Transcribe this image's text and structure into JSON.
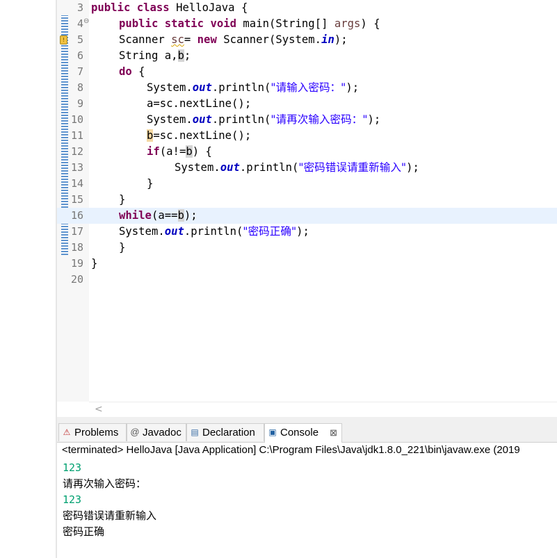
{
  "editor": {
    "lines": [
      {
        "num": "3",
        "tokens": [
          [
            "kw",
            "public"
          ],
          [
            "",
            "",
            " "
          ],
          [
            "kw",
            "class"
          ],
          [
            "",
            " HelloJava {"
          ]
        ]
      },
      {
        "num": "4",
        "fold": true
      },
      {
        "num": "5",
        "warning": true
      },
      {
        "num": "6"
      },
      {
        "num": "7"
      },
      {
        "num": "8"
      },
      {
        "num": "9"
      },
      {
        "num": "10"
      },
      {
        "num": "11"
      },
      {
        "num": "12"
      },
      {
        "num": "13"
      },
      {
        "num": "14"
      },
      {
        "num": "15"
      },
      {
        "num": "16",
        "current": true
      },
      {
        "num": "17"
      },
      {
        "num": "18"
      },
      {
        "num": "19"
      },
      {
        "num": "20"
      }
    ],
    "code": {
      "l3_kw1": "public",
      "l3_kw2": "class",
      "l3_rest": " HelloJava {",
      "l4_kw1": "public",
      "l4_kw2": "static",
      "l4_kw3": "void",
      "l4_rest1": " main(String[] ",
      "l4_args": "args",
      "l4_rest2": ") {",
      "l5_a": "Scanner ",
      "l5_sc": "sc",
      "l5_b": "= ",
      "l5_new": "new",
      "l5_c": " Scanner(System.",
      "l5_in": "in",
      "l5_d": ");",
      "l6_a": "String a,",
      "l6_b": "b",
      "l6_c": ";",
      "l7_do": "do",
      "l7_rest": " {",
      "l8_a": "System.",
      "l8_out": "out",
      "l8_b": ".println(",
      "l8_str": "\"请输入密码：\"",
      "l8_c": ");",
      "l9": "a=sc.nextLine();",
      "l10_a": "System.",
      "l10_out": "out",
      "l10_b": ".println(",
      "l10_str": "\"请再次输入密码：\"",
      "l10_c": ");",
      "l11_b": "b",
      "l11_rest": "=sc.nextLine();",
      "l12_if": "if",
      "l12_a": "(a!=",
      "l12_b": "b",
      "l12_c": ") {",
      "l13_a": "System.",
      "l13_out": "out",
      "l13_b": ".println(",
      "l13_str": "\"密码错误请重新输入\"",
      "l13_c": ");",
      "l14": "}",
      "l15": "}",
      "l16_while": "while",
      "l16_a": "(a==",
      "l16_b": "b",
      "l16_c": ");",
      "l17_a": "System.",
      "l17_out": "out",
      "l17_b": ".println(",
      "l17_str": "\"密码正确\"",
      "l17_c": ");",
      "l18": "}",
      "l19": "}",
      "l20": ""
    },
    "scroll_arrow": "<"
  },
  "console": {
    "tabs": [
      {
        "label": "Problems",
        "icon": "problems-icon"
      },
      {
        "label": "Javadoc",
        "icon": "javadoc-icon",
        "glyph": "@"
      },
      {
        "label": "Declaration",
        "icon": "declaration-icon"
      },
      {
        "label": "Console",
        "icon": "console-icon",
        "active": true,
        "close": "⊠"
      }
    ],
    "status": "<terminated> HelloJava [Java Application] C:\\Program Files\\Java\\jdk1.8.0_221\\bin\\javaw.exe (2019",
    "output": [
      {
        "text": "123",
        "kind": "input"
      },
      {
        "text": "请再次输入密码：",
        "kind": "normal"
      },
      {
        "text": "123",
        "kind": "input"
      },
      {
        "text": "密码错误请重新输入",
        "kind": "normal"
      },
      {
        "text": "密码正确",
        "kind": "normal"
      }
    ]
  },
  "colors": {
    "keyword": "#7f0055",
    "field": "#0000c0",
    "string": "#2a00ff",
    "console_input": "#00a070",
    "current_line": "#e8f2fe"
  }
}
